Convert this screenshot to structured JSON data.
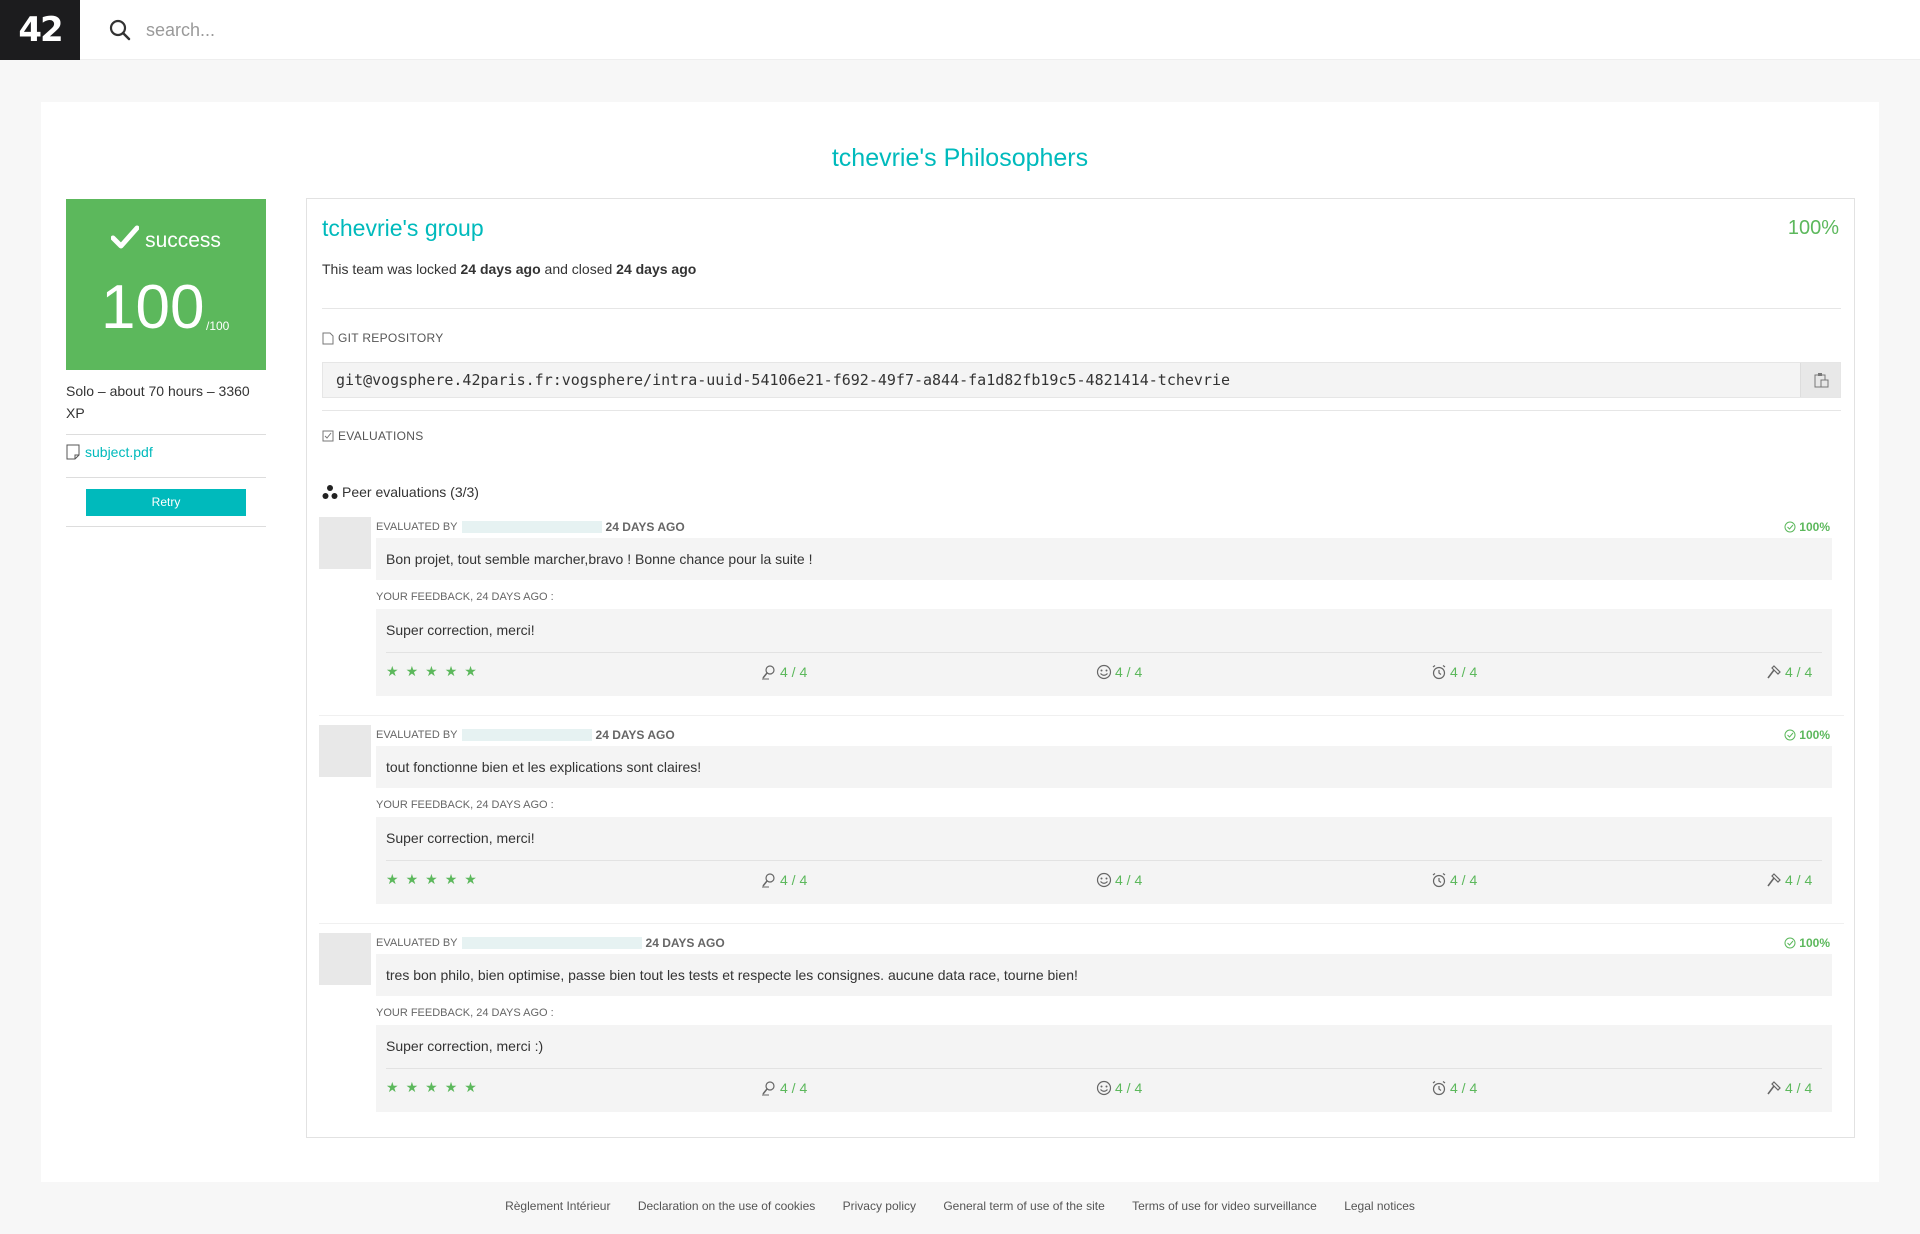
{
  "topbar": {
    "logo_text": "42",
    "search_placeholder": "search...",
    "search_value": ""
  },
  "page": {
    "title": "tchevrie's Philosophers"
  },
  "project": {
    "status": "success",
    "score": "100",
    "score_max": "/100",
    "meta": "Solo – about 70 hours – 3360 XP",
    "subject_link": "subject.pdf",
    "retry_label": "Retry",
    "status_color": "#5cb85c",
    "accent_color": "#00babc"
  },
  "group": {
    "name": "tchevrie's group",
    "percent": "100%",
    "locked_prefix": "This team was locked ",
    "locked_when": "24 days ago",
    "locked_mid": " and closed ",
    "closed_when": "24 days ago",
    "git_label": "GIT REPOSITORY",
    "git_url": "git@vogsphere.42paris.fr:vogsphere/intra-uuid-54106e21-f692-49f7-a844-fa1d82fb19c5-4821414-tchevrie",
    "evaluations_label": "EVALUATIONS",
    "peer_title": "Peer evaluations (3/3)"
  },
  "evaluations": [
    {
      "evaluated_by": "EVALUATED BY",
      "when": "24 DAYS AGO",
      "percent": "100%",
      "comment": "Bon projet, tout semble marcher,bravo ! Bonne chance pour la suite !",
      "feedback_label": "YOUR FEEDBACK, 24 DAYS AGO :",
      "feedback": "Super correction, merci!",
      "stars": 5,
      "ratings": [
        "4 / 4",
        "4 / 4",
        "4 / 4",
        "4 / 4"
      ]
    },
    {
      "evaluated_by": "EVALUATED BY",
      "when": "24 DAYS AGO",
      "percent": "100%",
      "comment": "tout fonctionne bien et les explications sont claires!",
      "feedback_label": "YOUR FEEDBACK, 24 DAYS AGO :",
      "feedback": "Super correction, merci!",
      "stars": 5,
      "ratings": [
        "4 / 4",
        "4 / 4",
        "4 / 4",
        "4 / 4"
      ]
    },
    {
      "evaluated_by": "EVALUATED BY",
      "when": "24 DAYS AGO",
      "percent": "100%",
      "comment": "tres bon philo, bien optimise, passe bien tout les tests et respecte les consignes. aucune data race, tourne bien!",
      "feedback_label": "YOUR FEEDBACK, 24 DAYS AGO :",
      "feedback": "Super correction, merci :)",
      "stars": 5,
      "ratings": [
        "4 / 4",
        "4 / 4",
        "4 / 4",
        "4 / 4"
      ]
    }
  ],
  "rating_icons": [
    "interested-icon",
    "smiley-icon",
    "alarm-clock-icon",
    "hammer-icon"
  ],
  "footer": {
    "links": [
      "Règlement Intérieur",
      "Declaration on the use of cookies",
      "Privacy policy",
      "General term of use of the site",
      "Terms of use for video surveillance",
      "Legal notices"
    ]
  }
}
